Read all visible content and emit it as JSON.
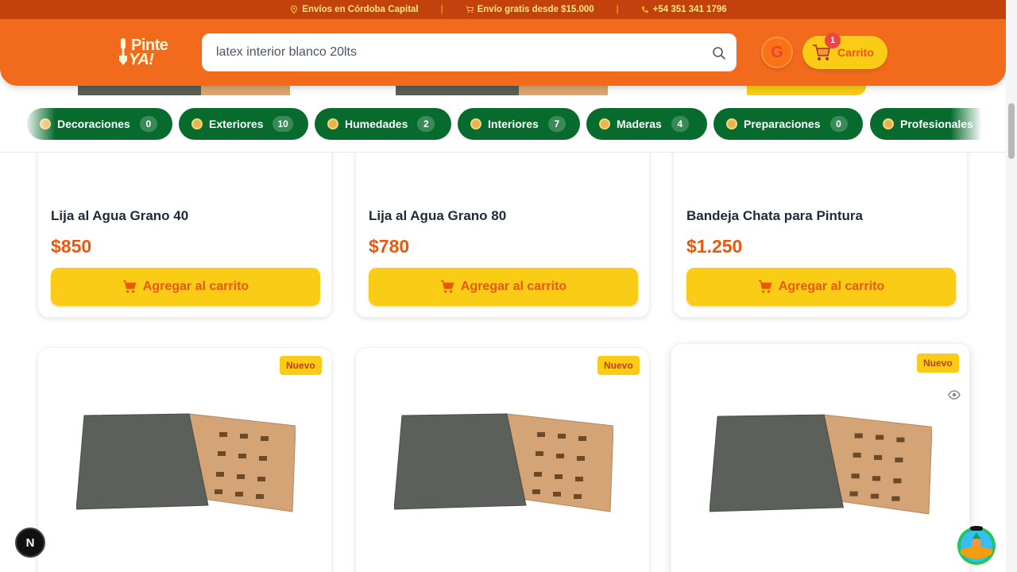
{
  "topbar": {
    "shipping": "Envíos en Córdoba Capital",
    "free_shipping": "Envío gratis desde $15.000",
    "phone": "+54 351 341 1796",
    "separator": "|"
  },
  "header": {
    "logo_line1": "Pinte",
    "logo_line2": "YA!",
    "search_value": "latex interior blanco 20lts",
    "google_label": "G",
    "cart_label": "Carrito",
    "cart_count": "1"
  },
  "categories": [
    {
      "label": "Decoraciones",
      "count": "0"
    },
    {
      "label": "Exteriores",
      "count": "10"
    },
    {
      "label": "Humedades",
      "count": "2"
    },
    {
      "label": "Interiores",
      "count": "7"
    },
    {
      "label": "Maderas",
      "count": "4"
    },
    {
      "label": "Preparaciones",
      "count": "0"
    },
    {
      "label": "Profesionales",
      "count": ""
    }
  ],
  "products_row1": [
    {
      "name": "Lija al Agua Grano 40",
      "price": "$850",
      "button": "Agregar al carrito"
    },
    {
      "name": "Lija al Agua Grano 80",
      "price": "$780",
      "button": "Agregar al carrito"
    },
    {
      "name": "Bandeja Chata para Pintura",
      "price": "$1.250",
      "button": "Agregar al carrito"
    }
  ],
  "products_row2": [
    {
      "badge": "Nuevo"
    },
    {
      "badge": "Nuevo"
    },
    {
      "badge": "Nuevo"
    }
  ],
  "floating": {
    "dev_button": "N"
  },
  "colors": {
    "brand_orange": "#f26b1d",
    "cta_yellow": "#facc15",
    "category_green": "#066b2d",
    "price_orange": "#ea580c"
  }
}
